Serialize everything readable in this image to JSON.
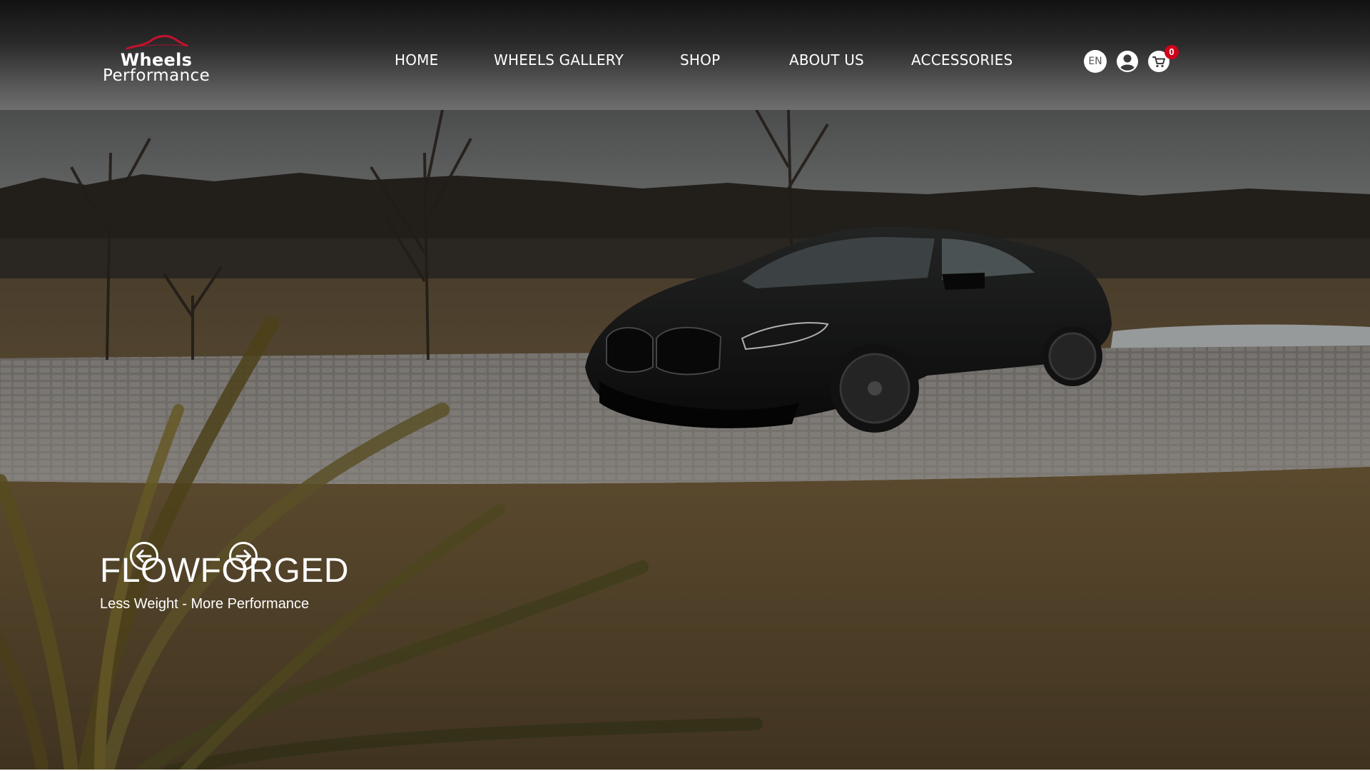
{
  "brand": {
    "line1": "Wheels",
    "line2": "Performance",
    "logo_icon": "car-roof-arc-icon",
    "accent_color": "#c8102e"
  },
  "nav": {
    "items": [
      {
        "label": "HOME"
      },
      {
        "label": "WHEELS GALLERY"
      },
      {
        "label": "SHOP"
      },
      {
        "label": "ABOUT US"
      },
      {
        "label": "ACCESSORIES"
      }
    ]
  },
  "header_actions": {
    "language": "EN",
    "user_icon": "user-circle-icon",
    "cart_icon": "cart-icon",
    "cart_count": "0",
    "badge_color": "#d0021b"
  },
  "hero": {
    "title": "FLOWFORGED",
    "subtitle": "Less Weight - More Performance",
    "prev_icon": "arrow-left-circle-icon",
    "next_icon": "arrow-right-circle-icon"
  }
}
